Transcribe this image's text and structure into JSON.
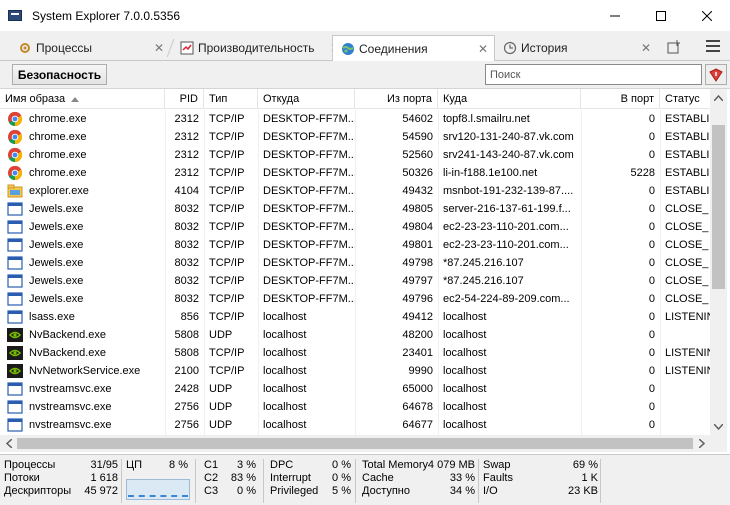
{
  "window": {
    "title": "System Explorer 7.0.0.5356",
    "minimize_glyph": "—",
    "maximize_glyph": "☐",
    "close_glyph": "✕"
  },
  "tabs": [
    {
      "label": "Процессы",
      "icon": "processes-icon",
      "active": false,
      "close": "✕"
    },
    {
      "label": "Производительность",
      "icon": "performance-icon",
      "active": false,
      "close": "✕"
    },
    {
      "label": "Соединения",
      "icon": "globe-icon",
      "active": true,
      "close": "✕"
    },
    {
      "label": "История",
      "icon": "clock-icon",
      "active": false,
      "close": "✕"
    }
  ],
  "toolbar": {
    "security_label": "Безопасность",
    "search_placeholder": "Поиск"
  },
  "table": {
    "headers": {
      "name": "Имя образа",
      "pid": "PID",
      "type": "Тип",
      "from": "Откуда",
      "from_port": "Из порта",
      "to": "Куда",
      "to_port": "В порт",
      "status": "Статус"
    },
    "rows": [
      {
        "icon": "chrome-icon",
        "name": "chrome.exe",
        "pid": "2312",
        "type": "TCP/IP",
        "from": "DESKTOP-FF7M...",
        "from_port": "54602",
        "to": "topf8.l.smailru.net",
        "to_port": "0",
        "status": "ESTABLI"
      },
      {
        "icon": "chrome-icon",
        "name": "chrome.exe",
        "pid": "2312",
        "type": "TCP/IP",
        "from": "DESKTOP-FF7M...",
        "from_port": "54590",
        "to": "srv120-131-240-87.vk.com",
        "to_port": "0",
        "status": "ESTABLI"
      },
      {
        "icon": "chrome-icon",
        "name": "chrome.exe",
        "pid": "2312",
        "type": "TCP/IP",
        "from": "DESKTOP-FF7M...",
        "from_port": "52560",
        "to": "srv241-143-240-87.vk.com",
        "to_port": "0",
        "status": "ESTABLI"
      },
      {
        "icon": "chrome-icon",
        "name": "chrome.exe",
        "pid": "2312",
        "type": "TCP/IP",
        "from": "DESKTOP-FF7M...",
        "from_port": "50326",
        "to": "li-in-f188.1e100.net",
        "to_port": "5228",
        "status": "ESTABLI"
      },
      {
        "icon": "explorer-icon",
        "name": "explorer.exe",
        "pid": "4104",
        "type": "TCP/IP",
        "from": "DESKTOP-FF7M...",
        "from_port": "49432",
        "to": "msnbot-191-232-139-87....",
        "to_port": "0",
        "status": "ESTABLI"
      },
      {
        "icon": "window-icon",
        "name": "Jewels.exe",
        "pid": "8032",
        "type": "TCP/IP",
        "from": "DESKTOP-FF7M...",
        "from_port": "49805",
        "to": "server-216-137-61-199.f...",
        "to_port": "0",
        "status": "CLOSE_"
      },
      {
        "icon": "window-icon",
        "name": "Jewels.exe",
        "pid": "8032",
        "type": "TCP/IP",
        "from": "DESKTOP-FF7M...",
        "from_port": "49804",
        "to": "ec2-23-23-110-201.com...",
        "to_port": "0",
        "status": "CLOSE_"
      },
      {
        "icon": "window-icon",
        "name": "Jewels.exe",
        "pid": "8032",
        "type": "TCP/IP",
        "from": "DESKTOP-FF7M...",
        "from_port": "49801",
        "to": "ec2-23-23-110-201.com...",
        "to_port": "0",
        "status": "CLOSE_"
      },
      {
        "icon": "window-icon",
        "name": "Jewels.exe",
        "pid": "8032",
        "type": "TCP/IP",
        "from": "DESKTOP-FF7M...",
        "from_port": "49798",
        "to": "*87.245.216.107",
        "to_port": "0",
        "status": "CLOSE_"
      },
      {
        "icon": "window-icon",
        "name": "Jewels.exe",
        "pid": "8032",
        "type": "TCP/IP",
        "from": "DESKTOP-FF7M...",
        "from_port": "49797",
        "to": "*87.245.216.107",
        "to_port": "0",
        "status": "CLOSE_"
      },
      {
        "icon": "window-icon",
        "name": "Jewels.exe",
        "pid": "8032",
        "type": "TCP/IP",
        "from": "DESKTOP-FF7M...",
        "from_port": "49796",
        "to": "ec2-54-224-89-209.com...",
        "to_port": "0",
        "status": "CLOSE_"
      },
      {
        "icon": "window-icon",
        "name": "lsass.exe",
        "pid": "856",
        "type": "TCP/IP",
        "from": "localhost",
        "from_port": "49412",
        "to": "localhost",
        "to_port": "0",
        "status": "LISTENIN"
      },
      {
        "icon": "nvidia-icon",
        "name": "NvBackend.exe",
        "pid": "5808",
        "type": "UDP",
        "from": "localhost",
        "from_port": "48200",
        "to": "localhost",
        "to_port": "0",
        "status": ""
      },
      {
        "icon": "nvidia-icon",
        "name": "NvBackend.exe",
        "pid": "5808",
        "type": "TCP/IP",
        "from": "localhost",
        "from_port": "23401",
        "to": "localhost",
        "to_port": "0",
        "status": "LISTENIN"
      },
      {
        "icon": "nvidia-icon",
        "name": "NvNetworkService.exe",
        "pid": "2100",
        "type": "TCP/IP",
        "from": "localhost",
        "from_port": "9990",
        "to": "localhost",
        "to_port": "0",
        "status": "LISTENIN"
      },
      {
        "icon": "window-icon",
        "name": "nvstreamsvc.exe",
        "pid": "2428",
        "type": "UDP",
        "from": "localhost",
        "from_port": "65000",
        "to": "localhost",
        "to_port": "0",
        "status": ""
      },
      {
        "icon": "window-icon",
        "name": "nvstreamsvc.exe",
        "pid": "2756",
        "type": "UDP",
        "from": "localhost",
        "from_port": "64678",
        "to": "localhost",
        "to_port": "0",
        "status": ""
      },
      {
        "icon": "window-icon",
        "name": "nvstreamsvc.exe",
        "pid": "2756",
        "type": "UDP",
        "from": "localhost",
        "from_port": "64677",
        "to": "localhost",
        "to_port": "0",
        "status": ""
      }
    ]
  },
  "status": {
    "processes": {
      "label": "Процессы",
      "value": "31/95"
    },
    "threads": {
      "label": "Потоки",
      "value": "1 618"
    },
    "handles": {
      "label": "Дескрипторы",
      "value": "45 972"
    },
    "cpu": {
      "label": "ЦП",
      "value": "8 %"
    },
    "c1": {
      "label": "C1",
      "value": "3 %"
    },
    "c2": {
      "label": "C2",
      "value": "83 %"
    },
    "c3": {
      "label": "C3",
      "value": "0 %"
    },
    "dpc": {
      "label": "DPC",
      "value": "0 %"
    },
    "interrupt": {
      "label": "Interrupt",
      "value": "0 %"
    },
    "privileged": {
      "label": "Privileged",
      "value": "5 %"
    },
    "total_memory": {
      "label": "Total Memory",
      "value": "4 079 MB"
    },
    "cache": {
      "label": "Cache",
      "value": "33 %"
    },
    "available": {
      "label": "Доступно",
      "value": "34 %"
    },
    "swap": {
      "label": "Swap",
      "value": "69 %"
    },
    "faults": {
      "label": "Faults",
      "value": "1 K"
    },
    "io": {
      "label": "I/O",
      "value": "23 KB"
    }
  }
}
